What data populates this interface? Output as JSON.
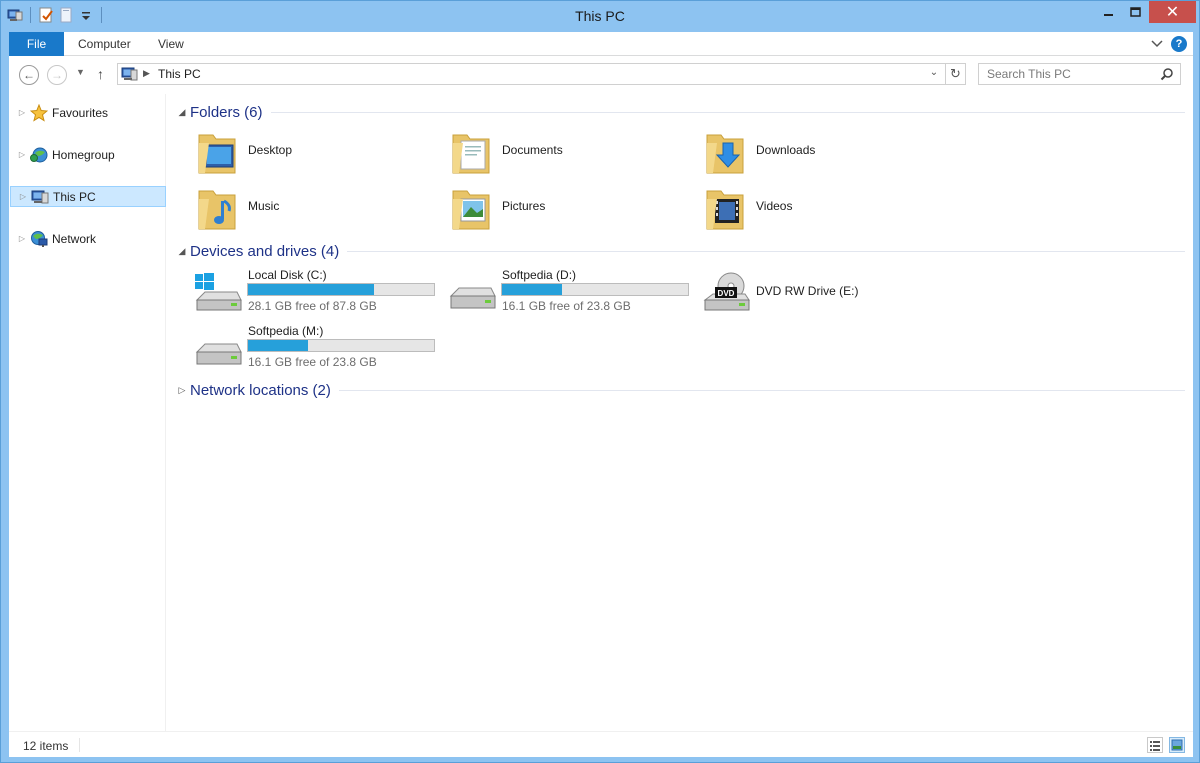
{
  "window": {
    "title": "This PC",
    "close_glyph": "✕",
    "maximize_glyph": "□",
    "minimize_glyph": "—"
  },
  "ribbon": {
    "tabs": [
      {
        "label": "File",
        "active": true
      },
      {
        "label": "Computer",
        "active": false
      },
      {
        "label": "View",
        "active": false
      }
    ],
    "help_glyph": "?",
    "expand_glyph": "⌄"
  },
  "address": {
    "back_glyph": "←",
    "forward_glyph": "→",
    "recent_glyph": "▼",
    "up_glyph": "↑",
    "crumb": "This PC",
    "crumb_arrow": "▶",
    "dropdown_glyph": "⌄",
    "refresh_glyph": "↻"
  },
  "search": {
    "placeholder": "Search This PC",
    "value": ""
  },
  "navpane": {
    "items": [
      {
        "label": "Favourites",
        "icon": "star-icon",
        "selected": false
      },
      {
        "label": "Homegroup",
        "icon": "homegroup-icon",
        "selected": false
      },
      {
        "label": "This PC",
        "icon": "computer-icon",
        "selected": true
      },
      {
        "label": "Network",
        "icon": "network-icon",
        "selected": false
      }
    ],
    "expand_glyph": "▷"
  },
  "groups": {
    "folders": {
      "title": "Folders (6)",
      "expand_glyph": "◢"
    },
    "devices": {
      "title": "Devices and drives (4)",
      "expand_glyph": "◢"
    },
    "network": {
      "title": "Network locations (2)",
      "expand_glyph": "▷"
    }
  },
  "folders": [
    {
      "label": "Desktop",
      "icon": "desktop-folder-icon"
    },
    {
      "label": "Documents",
      "icon": "documents-folder-icon"
    },
    {
      "label": "Downloads",
      "icon": "downloads-folder-icon"
    },
    {
      "label": "Music",
      "icon": "music-folder-icon"
    },
    {
      "label": "Pictures",
      "icon": "pictures-folder-icon"
    },
    {
      "label": "Videos",
      "icon": "videos-folder-icon"
    }
  ],
  "drives": [
    {
      "name": "Local Disk (C:)",
      "free": "28.1 GB free of 87.8 GB",
      "used_fraction": 0.68,
      "icon": "windows-drive-icon"
    },
    {
      "name": "Softpedia (D:)",
      "free": "16.1 GB free of 23.8 GB",
      "used_fraction": 0.32,
      "icon": "hard-drive-icon"
    },
    {
      "name": "DVD RW Drive (E:)",
      "icon": "dvd-drive-icon",
      "dvd_label": "DVD"
    },
    {
      "name": "Softpedia (M:)",
      "free": "16.1 GB free of 23.8 GB",
      "used_fraction": 0.32,
      "icon": "hard-drive-icon"
    }
  ],
  "status": {
    "count": "12 items"
  },
  "colors": {
    "accent": "#1979ca",
    "title_bar": "#8dc3f1",
    "group_title": "#1e3287",
    "drive_fill": "#26a0da",
    "selection": "#cce8ff"
  }
}
